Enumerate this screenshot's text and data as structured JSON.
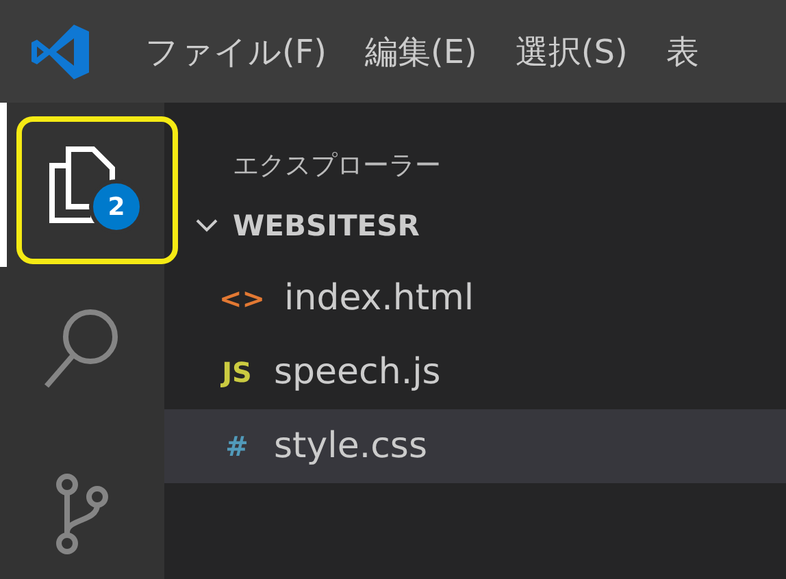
{
  "menu_bar": {
    "items": [
      {
        "label": "ファイル(F)"
      },
      {
        "label": "編集(E)"
      },
      {
        "label": "選択(S)"
      },
      {
        "label": "表"
      }
    ]
  },
  "activity_bar": {
    "items": [
      {
        "kind": "files",
        "selected": true,
        "badge": "2",
        "highlighted": true
      },
      {
        "kind": "search",
        "selected": false
      },
      {
        "kind": "source-control",
        "selected": false
      }
    ]
  },
  "sidebar": {
    "title": "エクスプローラー",
    "folder": {
      "name": "WEBSITESR",
      "expanded": true,
      "files": [
        {
          "name": "index.html",
          "kind": "html",
          "icon": "<>",
          "selected": false
        },
        {
          "name": "speech.js",
          "kind": "js",
          "icon": "JS",
          "selected": false
        },
        {
          "name": "style.css",
          "kind": "css",
          "icon": "#",
          "selected": true
        }
      ]
    }
  }
}
